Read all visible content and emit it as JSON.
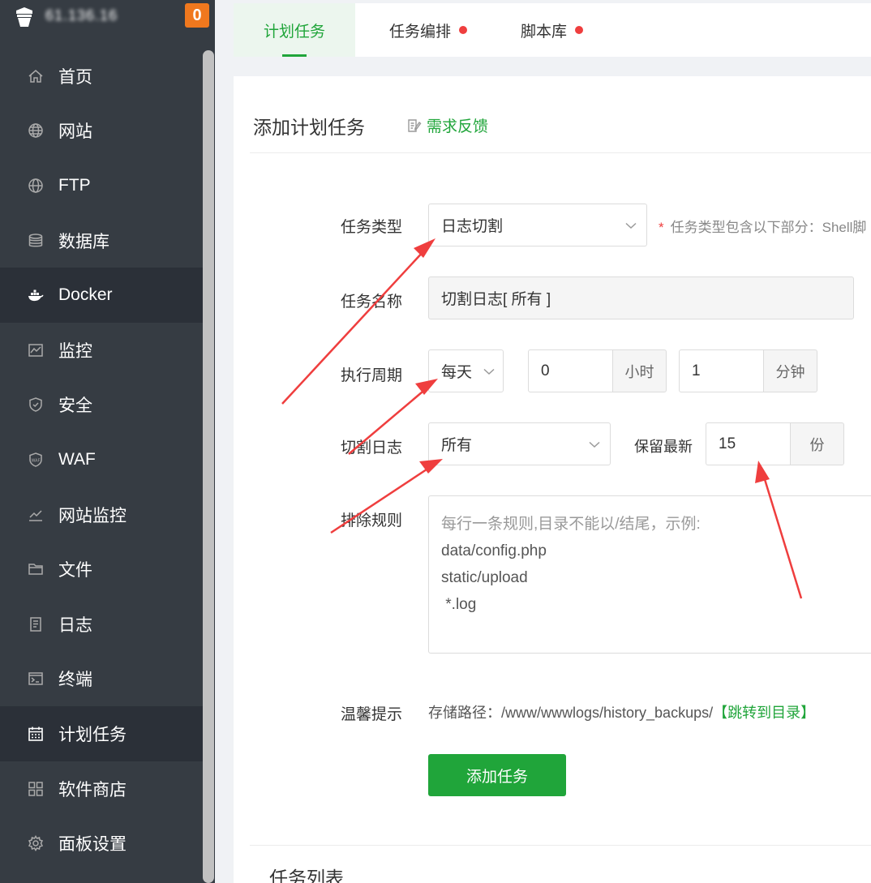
{
  "header": {
    "server_ip": "61.136.16",
    "message_count": "0"
  },
  "sidebar": {
    "items": [
      {
        "label": "首页",
        "icon": "home-icon"
      },
      {
        "label": "网站",
        "icon": "globe-icon"
      },
      {
        "label": "FTP",
        "icon": "ftp-icon"
      },
      {
        "label": "数据库",
        "icon": "database-icon"
      },
      {
        "label": "Docker",
        "icon": "docker-icon"
      },
      {
        "label": "监控",
        "icon": "monitor-icon"
      },
      {
        "label": "安全",
        "icon": "shield-icon"
      },
      {
        "label": "WAF",
        "icon": "waf-icon"
      },
      {
        "label": "网站监控",
        "icon": "chart-icon"
      },
      {
        "label": "文件",
        "icon": "folder-icon"
      },
      {
        "label": "日志",
        "icon": "log-icon"
      },
      {
        "label": "终端",
        "icon": "terminal-icon"
      },
      {
        "label": "计划任务",
        "icon": "calendar-icon"
      },
      {
        "label": "软件商店",
        "icon": "grid-icon"
      },
      {
        "label": "面板设置",
        "icon": "gear-icon"
      }
    ],
    "active_item": "计划任务"
  },
  "tabs": [
    {
      "label": "计划任务",
      "active": true
    },
    {
      "label": "任务编排",
      "active": false,
      "dot": true
    },
    {
      "label": "脚本库",
      "active": false,
      "dot": true
    }
  ],
  "panel": {
    "title": "添加计划任务",
    "feedback": "需求反馈"
  },
  "form": {
    "task_type_label": "任务类型",
    "task_type_value": "日志切割",
    "task_type_hint": "任务类型包含以下部分：Shell脚",
    "task_name_label": "任务名称",
    "task_name_value": "切割日志[ 所有 ]",
    "cycle_label": "执行周期",
    "cycle_value": "每天",
    "hour_value": "0",
    "hour_unit": "小时",
    "minute_value": "1",
    "minute_unit": "分钟",
    "cut_log_label": "切割日志",
    "cut_log_value": "所有",
    "keep_label": "保留最新",
    "keep_value": "15",
    "keep_unit": "份",
    "exclude_label": "排除规则",
    "exclude_lines": [
      "每行一条规则,目录不能以/结尾，示例:",
      "data/config.php",
      "static/upload",
      " *.log"
    ],
    "tip_label": "温馨提示",
    "tip_path": "存储路径：/www/wwwlogs/history_backups/",
    "tip_link": "【跳转到目录】",
    "submit": "添加任务"
  },
  "list": {
    "title": "任务列表"
  },
  "colors": {
    "primary_green": "#20a53a",
    "sidebar_bg": "#363c43",
    "sidebar_active": "#2b3038",
    "badge_orange": "#f0781e",
    "alert_red": "#ef3e3e"
  }
}
